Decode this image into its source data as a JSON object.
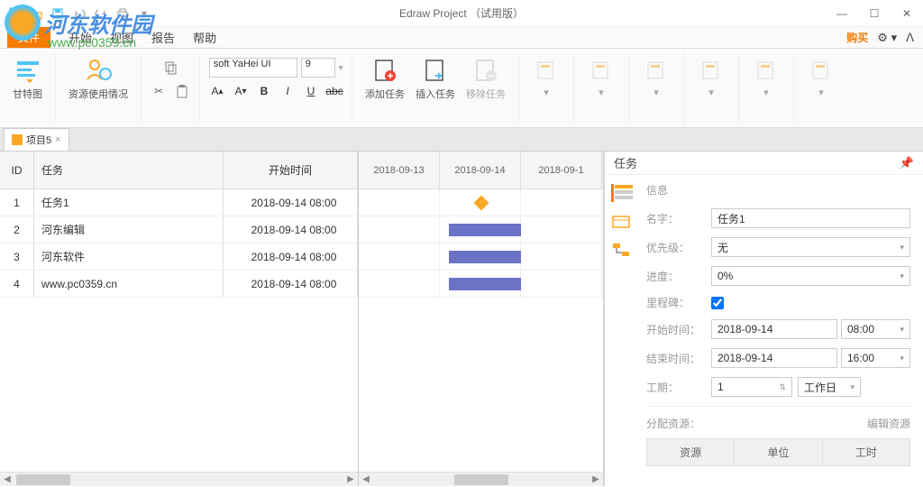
{
  "title": "Edraw Project （试用版）",
  "watermark": {
    "text": "河东软件园",
    "url": "www.pc0359.cn"
  },
  "menubar": {
    "file": "文件",
    "items": [
      "开始",
      "视图",
      "报告",
      "帮助"
    ],
    "buy": "购买"
  },
  "ribbon": {
    "gantt": "甘特图",
    "resource": "资源使用情况",
    "font_name": "soft YaHei UI",
    "font_size": "9",
    "add_task": "添加任务",
    "insert_task": "插入任务",
    "remove_task": "移除任务"
  },
  "tab": {
    "name": "项目5"
  },
  "table": {
    "headers": {
      "id": "ID",
      "task": "任务",
      "start": "开始时间"
    },
    "rows": [
      {
        "id": "1",
        "task": "任务1",
        "start": "2018-09-14 08:00"
      },
      {
        "id": "2",
        "task": "河东编辑",
        "start": "2018-09-14 08:00"
      },
      {
        "id": "3",
        "task": "河东软件",
        "start": "2018-09-14 08:00"
      },
      {
        "id": "4",
        "task": "www.pc0359.cn",
        "start": "2018-09-14 08:00"
      }
    ]
  },
  "gantt": {
    "dates": [
      "2018-09-13",
      "2018-09-14",
      "2018-09-1"
    ]
  },
  "side": {
    "title": "任务",
    "section": "信息",
    "labels": {
      "name": "名字：",
      "priority": "优先级：",
      "progress": "进度：",
      "milestone": "里程碑：",
      "start": "开始时间：",
      "end": "结束时间：",
      "duration": "工期：",
      "assign": "分配资源：",
      "edit_res": "编辑资源"
    },
    "values": {
      "name": "任务1",
      "priority": "无",
      "progress": "0%",
      "milestone": true,
      "start_date": "2018-09-14",
      "start_time": "08:00",
      "end_date": "2018-09-14",
      "end_time": "16:00",
      "duration": "1",
      "duration_unit": "工作日"
    },
    "tabs": [
      "资源",
      "单位",
      "工时"
    ]
  }
}
